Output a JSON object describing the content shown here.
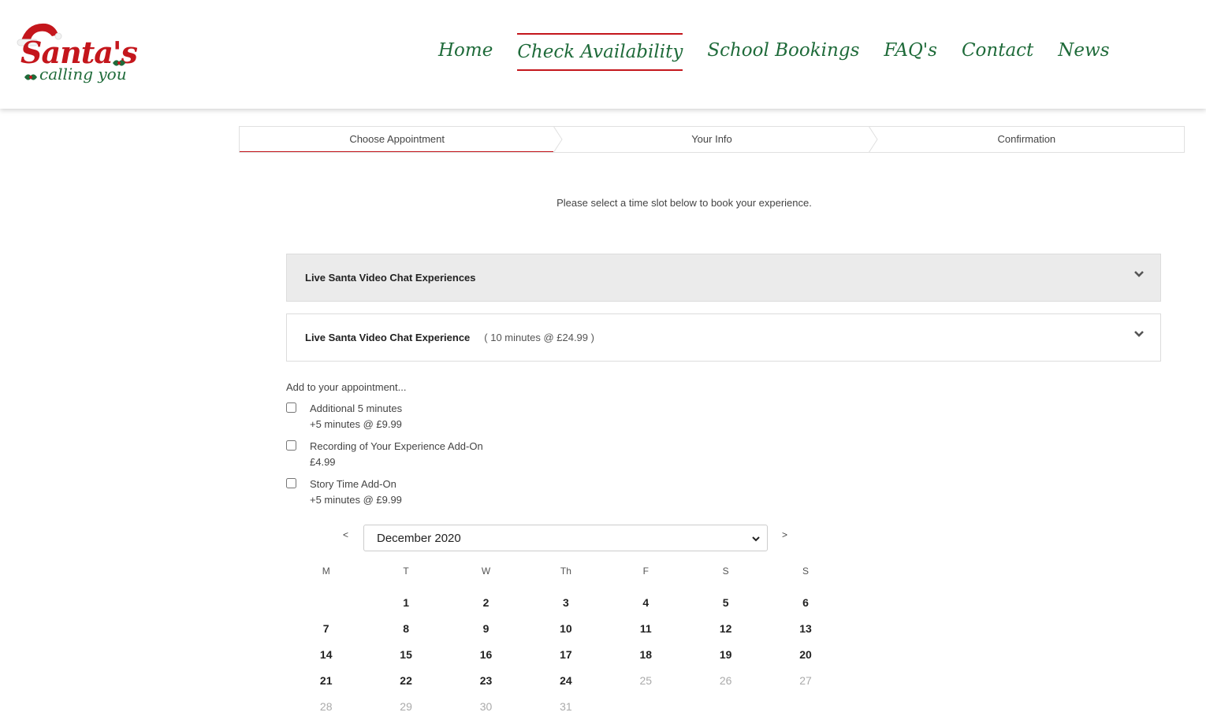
{
  "logo": {
    "line1": "Santa's",
    "line2": "calling you"
  },
  "nav": [
    {
      "label": "Home",
      "active": false
    },
    {
      "label": "Check Availability",
      "active": true
    },
    {
      "label": "School Bookings",
      "active": false
    },
    {
      "label": "FAQ's",
      "active": false
    },
    {
      "label": "Contact",
      "active": false
    },
    {
      "label": "News",
      "active": false
    }
  ],
  "steps": [
    "Choose Appointment",
    "Your Info",
    "Confirmation"
  ],
  "intro": "Please select a time slot below to book your experience.",
  "accordions": [
    {
      "title": "Live Santa Video Chat Experiences",
      "subtitle": ""
    },
    {
      "title": "Live Santa Video Chat Experience",
      "subtitle": "( 10 minutes @ £24.99 )"
    }
  ],
  "addons": {
    "heading": "Add to your appointment...",
    "items": [
      {
        "label": "Additional 5 minutes",
        "detail": "+5 minutes @ £9.99",
        "checked": false
      },
      {
        "label": "Recording of Your Experience Add-On",
        "detail": "£4.99",
        "checked": false
      },
      {
        "label": "Story Time Add-On",
        "detail": "+5 minutes @ £9.99",
        "checked": false
      }
    ]
  },
  "calendar": {
    "prev": "<",
    "next": ">",
    "month": "December 2020",
    "weekdays": [
      "M",
      "T",
      "W",
      "Th",
      "F",
      "S",
      "S"
    ],
    "weeks": [
      [
        {
          "d": ""
        },
        {
          "d": "1"
        },
        {
          "d": "2"
        },
        {
          "d": "3"
        },
        {
          "d": "4"
        },
        {
          "d": "5"
        },
        {
          "d": "6"
        }
      ],
      [
        {
          "d": "7"
        },
        {
          "d": "8"
        },
        {
          "d": "9"
        },
        {
          "d": "10"
        },
        {
          "d": "11"
        },
        {
          "d": "12"
        },
        {
          "d": "13"
        }
      ],
      [
        {
          "d": "14"
        },
        {
          "d": "15"
        },
        {
          "d": "16"
        },
        {
          "d": "17"
        },
        {
          "d": "18"
        },
        {
          "d": "19"
        },
        {
          "d": "20"
        }
      ],
      [
        {
          "d": "21"
        },
        {
          "d": "22"
        },
        {
          "d": "23"
        },
        {
          "d": "24"
        },
        {
          "d": "25",
          "off": true
        },
        {
          "d": "26",
          "off": true
        },
        {
          "d": "27",
          "off": true
        }
      ],
      [
        {
          "d": "28",
          "off": true
        },
        {
          "d": "29",
          "off": true
        },
        {
          "d": "30",
          "off": true
        },
        {
          "d": "31",
          "off": true
        },
        {
          "d": ""
        },
        {
          "d": ""
        },
        {
          "d": ""
        }
      ]
    ]
  },
  "colors": {
    "accent": "#c4161c",
    "nav_green": "#1f6b3a",
    "panel_grey": "#ebebeb"
  }
}
